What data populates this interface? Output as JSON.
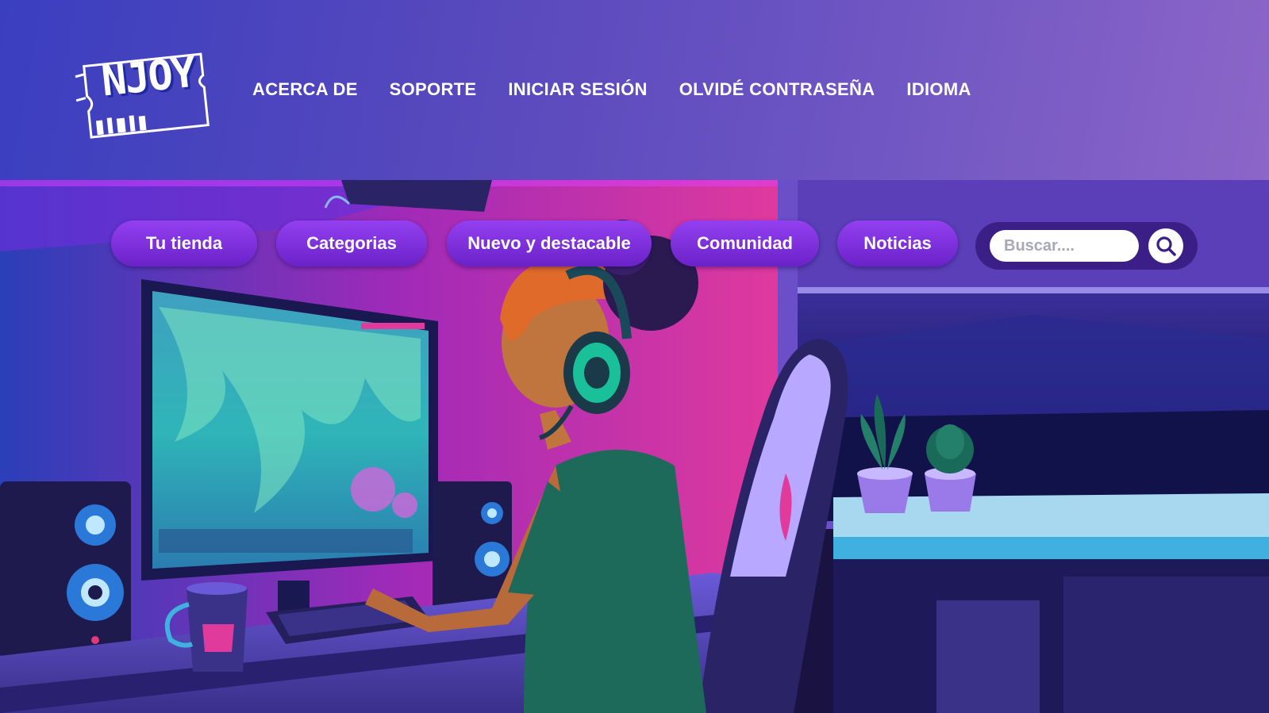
{
  "brand": {
    "logo_text": "NJOY"
  },
  "top_nav": [
    {
      "label": "ACERCA DE"
    },
    {
      "label": "SOPORTE"
    },
    {
      "label": "INICIAR SESIÓN"
    },
    {
      "label": "OLVIDÉ CONTRASEÑA"
    },
    {
      "label": "IDIOMA"
    }
  ],
  "pill_nav": [
    {
      "label": "Tu tienda"
    },
    {
      "label": "Categorias"
    },
    {
      "label": "Nuevo y destacable"
    },
    {
      "label": "Comunidad"
    },
    {
      "label": "Noticias"
    }
  ],
  "search": {
    "placeholder": "Buscar...."
  },
  "icons": {
    "search": "search-icon"
  },
  "colors": {
    "header_start": "#3a3fc0",
    "header_end": "#8c66c8",
    "pill": "#7a2ee0",
    "search_bg": "#3b1f86"
  }
}
